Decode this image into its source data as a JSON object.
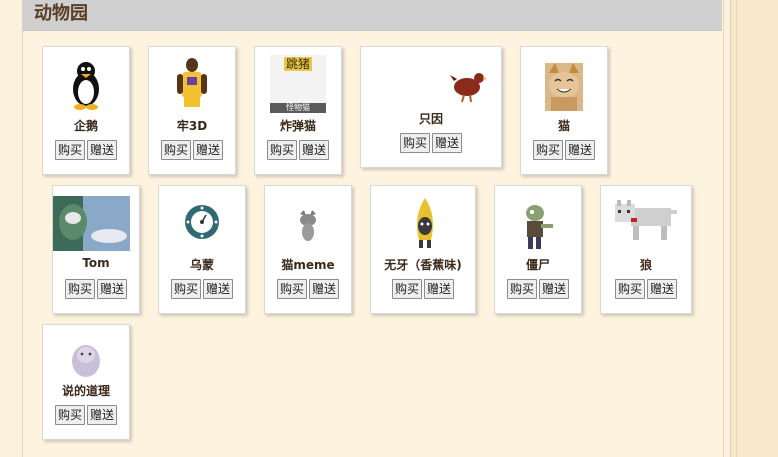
{
  "section": {
    "title": "动物园"
  },
  "actions": {
    "buy": "购买",
    "gift": "赠送"
  },
  "items": [
    {
      "name": "企鹅",
      "icon": "penguin-icon"
    },
    {
      "name": "牢3D",
      "icon": "basketball-player-icon"
    },
    {
      "name": "炸弹猫",
      "icon": "bomb-cat-icon",
      "image_caption_top": "跳猪",
      "image_caption_bottom": "怪物猫"
    },
    {
      "name": "只因",
      "icon": "chicken-icon"
    },
    {
      "name": "猫",
      "icon": "smiling-cat-icon"
    },
    {
      "name": "Tom",
      "icon": "tom-cat-icon"
    },
    {
      "name": "乌蒙",
      "icon": "clock-dial-icon"
    },
    {
      "name": "猫meme",
      "icon": "meme-cat-icon"
    },
    {
      "name": "无牙（香蕉味)",
      "icon": "banana-cat-icon"
    },
    {
      "name": "僵尸",
      "icon": "zombie-icon"
    },
    {
      "name": "狼",
      "icon": "wolf-icon"
    },
    {
      "name": "说的道理",
      "icon": "ghost-face-icon"
    }
  ]
}
